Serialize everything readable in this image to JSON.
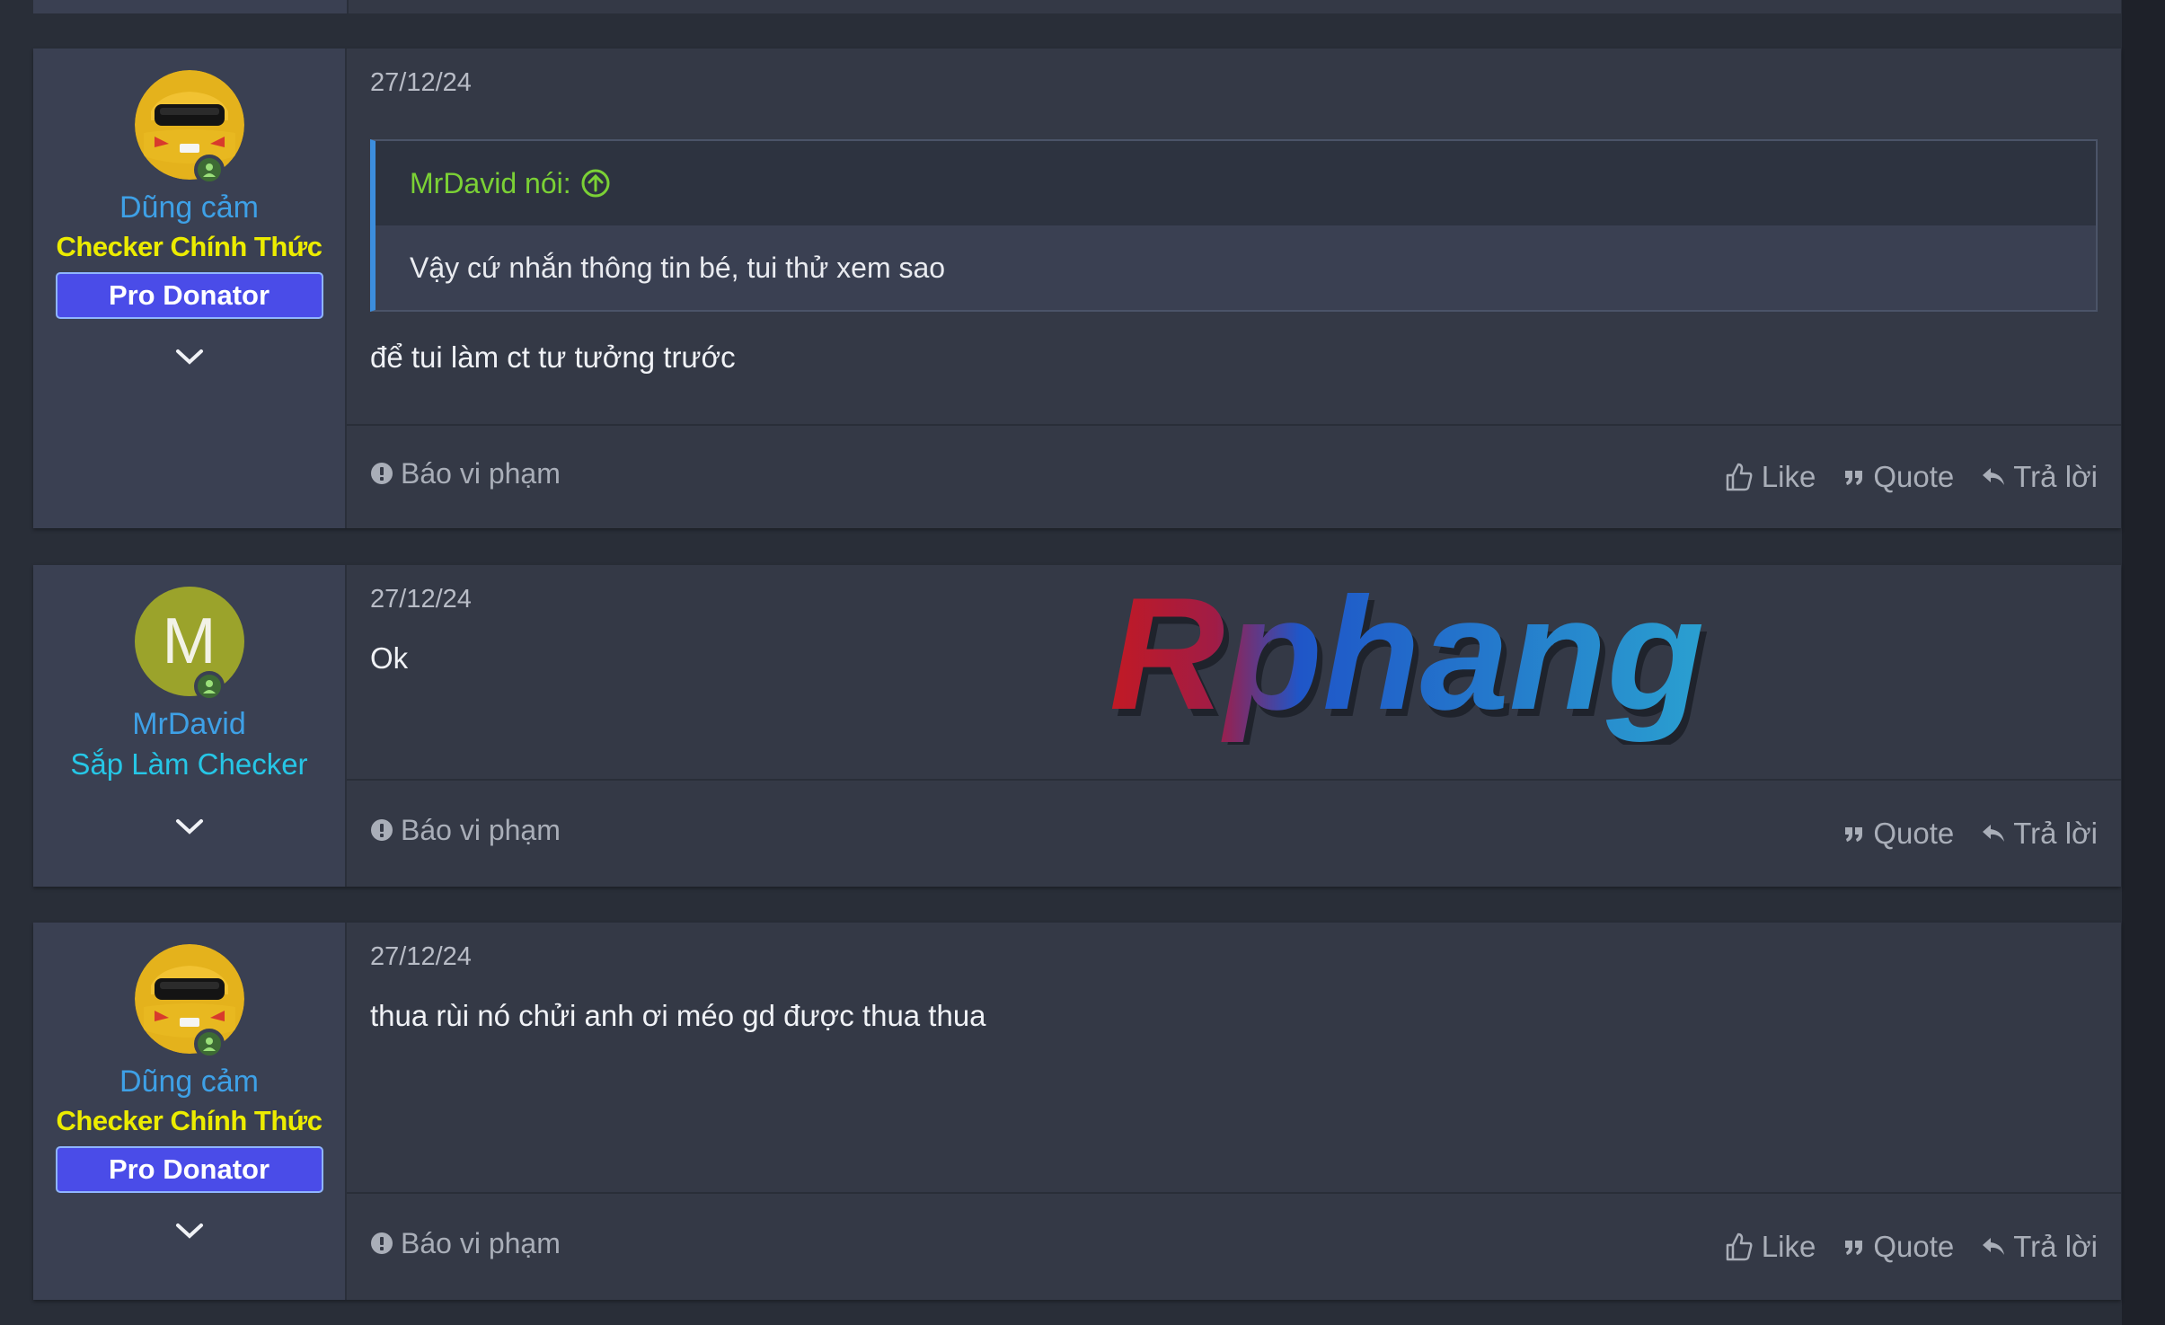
{
  "posts": [
    {
      "user": {
        "name": "Dũng cảm",
        "title": "Checker Chính Thức",
        "badge": "Pro Donator"
      },
      "date": "27/12/24",
      "quote": {
        "author": "MrDavid nói:",
        "text": "Vậy cứ nhắn thông tin bé, tui thử xem sao"
      },
      "message": "để tui làm ct tư tưởng trước",
      "footer": {
        "report": "Báo vi phạm",
        "like": "Like",
        "quote": "Quote",
        "reply": "Trả lời"
      }
    },
    {
      "user": {
        "avatar_letter": "M",
        "name": "MrDavid",
        "title": "Sắp Làm Checker"
      },
      "date": "27/12/24",
      "message": "Ok",
      "footer": {
        "report": "Báo vi phạm",
        "quote": "Quote",
        "reply": "Trả lời"
      }
    },
    {
      "user": {
        "name": "Dũng cảm",
        "title": "Checker Chính Thức",
        "badge": "Pro Donator"
      },
      "date": "27/12/24",
      "message": "thua rùi nó chửi anh ơi méo gd được thua thua",
      "footer": {
        "report": "Báo vi phạm",
        "like": "Like",
        "quote": "Quote",
        "reply": "Trả lời"
      }
    }
  ],
  "watermark": "Rphang",
  "colors": {
    "page_bg": "#292e38",
    "post_bg": "#343946",
    "user_panel_bg": "#3a4052",
    "username": "#3ea0e6",
    "title_gold": "#ecec00",
    "title_cyan": "#26c6e6",
    "badge_bg": "#4a4ce8",
    "quote_accent": "#3c8ede",
    "quote_author": "#7bd135"
  }
}
